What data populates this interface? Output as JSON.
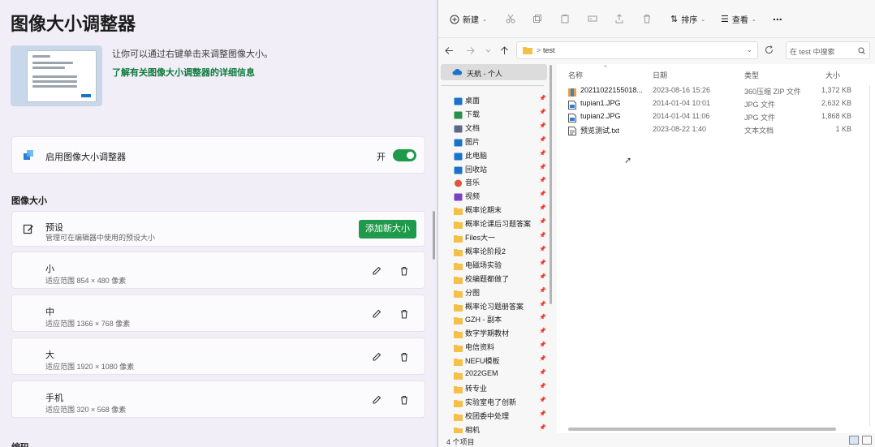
{
  "left": {
    "title": "图像大小调整器",
    "description": "让你可以通过右键单击来调整图像大小。",
    "learn_more": "了解有关图像大小调整器的详细信息",
    "enable": {
      "label": "启用图像大小调整器",
      "state_text": "开"
    },
    "section_title": "图像大小",
    "preset": {
      "title": "预设",
      "subtitle": "管理可在编辑器中使用的预设大小",
      "add_button": "添加新大小"
    },
    "sizes": [
      {
        "name": "小",
        "detail": "适应范围 854 × 480 像素"
      },
      {
        "name": "中",
        "detail": "适应范围 1366 × 768 像素"
      },
      {
        "name": "大",
        "detail": "适应范围 1920 × 1080 像素"
      },
      {
        "name": "手机",
        "detail": "适应范围 320 × 568 像素"
      }
    ],
    "bottom_section": "编码",
    "accent": "#1f9a4a"
  },
  "explorer": {
    "toolbar": {
      "new": "新建",
      "sort": "排序",
      "view": "查看",
      "more": "..."
    },
    "address": {
      "path_sep": ">",
      "folder": "test"
    },
    "search_placeholder": "在 test 中搜索",
    "nav_top": "天航 - 个人",
    "nav_items": [
      {
        "label": "桌面",
        "icon": "desktop-icon"
      },
      {
        "label": "下载",
        "icon": "download-icon"
      },
      {
        "label": "文档",
        "icon": "document-icon"
      },
      {
        "label": "图片",
        "icon": "picture-icon"
      },
      {
        "label": "此电脑",
        "icon": "computer-icon"
      },
      {
        "label": "回收站",
        "icon": "recycle-bin-icon"
      },
      {
        "label": "音乐",
        "icon": "music-icon"
      },
      {
        "label": "视频",
        "icon": "video-icon"
      },
      {
        "label": "概率论期末",
        "icon": "folder-icon"
      },
      {
        "label": "概率论课后习题答案",
        "icon": "folder-icon"
      },
      {
        "label": "Files大一",
        "icon": "folder-icon"
      },
      {
        "label": "概率论阶段2",
        "icon": "folder-icon"
      },
      {
        "label": "电磁场实验",
        "icon": "folder-icon"
      },
      {
        "label": "校编题都做了",
        "icon": "folder-icon"
      },
      {
        "label": "分图",
        "icon": "folder-icon"
      },
      {
        "label": "概率论习题册答案",
        "icon": "folder-icon"
      },
      {
        "label": "GZH - 副本",
        "icon": "folder-icon"
      },
      {
        "label": "数字学期教材",
        "icon": "folder-icon"
      },
      {
        "label": "电信资料",
        "icon": "folder-icon"
      },
      {
        "label": "NEFU模板",
        "icon": "folder-icon"
      },
      {
        "label": "2022GEM",
        "icon": "folder-icon"
      },
      {
        "label": "转专业",
        "icon": "folder-icon"
      },
      {
        "label": "实验室电了创新",
        "icon": "folder-icon"
      },
      {
        "label": "校团委中处理",
        "icon": "folder-icon"
      },
      {
        "label": "相机",
        "icon": "folder-icon"
      }
    ],
    "columns": {
      "name": "名称",
      "date": "日期",
      "type": "类型",
      "size": "大小"
    },
    "files": [
      {
        "name": "20211022155018...",
        "date": "2023-08-16 15:26",
        "type": "360压缩 ZIP 文件",
        "size": "1,372 KB",
        "icon": "zip-icon"
      },
      {
        "name": "tupian1.JPG",
        "date": "2014-01-04 10:01",
        "type": "JPG 文件",
        "size": "2,632 KB",
        "icon": "image-file-icon"
      },
      {
        "name": "tupian2.JPG",
        "date": "2014-01-04 11:06",
        "type": "JPG 文件",
        "size": "1,868 KB",
        "icon": "image-file-icon"
      },
      {
        "name": "预览测试.txt",
        "date": "2023-08-22 1:40",
        "type": "文本文档",
        "size": "1 KB",
        "icon": "text-file-icon"
      }
    ],
    "status": "4 个项目"
  }
}
